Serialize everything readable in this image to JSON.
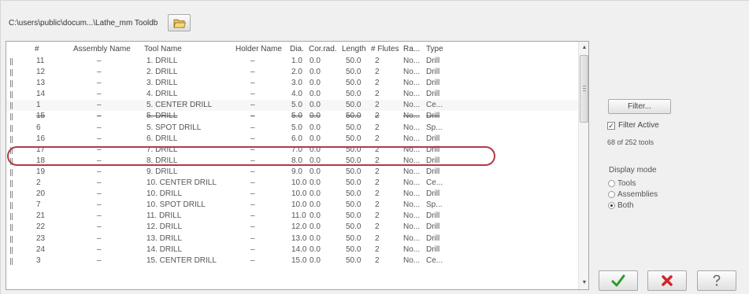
{
  "path": {
    "text": "C:\\users\\public\\docum...\\Lathe_mm Tooldb",
    "browse_icon": "folder-open-icon"
  },
  "columns": [
    "#",
    "Assembly Name",
    "Tool Name",
    "Holder Name",
    "Dia.",
    "Cor.rad.",
    "Length",
    "# Flutes",
    "Ra...",
    "Type"
  ],
  "rows": [
    {
      "num": "11",
      "assembly": "–",
      "tool": "1. DRILL",
      "holder": "–",
      "dia": "1.0",
      "cor": "0.0",
      "length": "50.0",
      "flutes": "2",
      "ra": "No...",
      "type": "Drill"
    },
    {
      "num": "12",
      "assembly": "–",
      "tool": "2. DRILL",
      "holder": "–",
      "dia": "2.0",
      "cor": "0.0",
      "length": "50.0",
      "flutes": "2",
      "ra": "No...",
      "type": "Drill"
    },
    {
      "num": "13",
      "assembly": "–",
      "tool": "3. DRILL",
      "holder": "–",
      "dia": "3.0",
      "cor": "0.0",
      "length": "50.0",
      "flutes": "2",
      "ra": "No...",
      "type": "Drill"
    },
    {
      "num": "14",
      "assembly": "–",
      "tool": "4. DRILL",
      "holder": "–",
      "dia": "4.0",
      "cor": "0.0",
      "length": "50.0",
      "flutes": "2",
      "ra": "No...",
      "type": "Drill"
    },
    {
      "num": "1",
      "assembly": "–",
      "tool": "5. CENTER DRILL",
      "holder": "–",
      "dia": "5.0",
      "cor": "0.0",
      "length": "50.0",
      "flutes": "2",
      "ra": "No...",
      "type": "Ce..."
    },
    {
      "num": "15",
      "assembly": "–",
      "tool": "5. DRILL",
      "holder": "–",
      "dia": "5.0",
      "cor": "0.0",
      "length": "50.0",
      "flutes": "2",
      "ra": "No...",
      "type": "Drill"
    },
    {
      "num": "6",
      "assembly": "–",
      "tool": "5. SPOT DRILL",
      "holder": "–",
      "dia": "5.0",
      "cor": "0.0",
      "length": "50.0",
      "flutes": "2",
      "ra": "No...",
      "type": "Sp..."
    },
    {
      "num": "16",
      "assembly": "–",
      "tool": "6. DRILL",
      "holder": "–",
      "dia": "6.0",
      "cor": "0.0",
      "length": "50.0",
      "flutes": "2",
      "ra": "No...",
      "type": "Drill"
    },
    {
      "num": "17",
      "assembly": "–",
      "tool": "7. DRILL",
      "holder": "–",
      "dia": "7.0",
      "cor": "0.0",
      "length": "50.0",
      "flutes": "2",
      "ra": "No...",
      "type": "Drill"
    },
    {
      "num": "18",
      "assembly": "–",
      "tool": "8. DRILL",
      "holder": "–",
      "dia": "8.0",
      "cor": "0.0",
      "length": "50.0",
      "flutes": "2",
      "ra": "No...",
      "type": "Drill"
    },
    {
      "num": "19",
      "assembly": "–",
      "tool": "9. DRILL",
      "holder": "–",
      "dia": "9.0",
      "cor": "0.0",
      "length": "50.0",
      "flutes": "2",
      "ra": "No...",
      "type": "Drill"
    },
    {
      "num": "2",
      "assembly": "–",
      "tool": "10. CENTER DRILL",
      "holder": "–",
      "dia": "10.0",
      "cor": "0.0",
      "length": "50.0",
      "flutes": "2",
      "ra": "No...",
      "type": "Ce..."
    },
    {
      "num": "20",
      "assembly": "–",
      "tool": "10. DRILL",
      "holder": "–",
      "dia": "10.0",
      "cor": "0.0",
      "length": "50.0",
      "flutes": "2",
      "ra": "No...",
      "type": "Drill"
    },
    {
      "num": "7",
      "assembly": "–",
      "tool": "10. SPOT DRILL",
      "holder": "–",
      "dia": "10.0",
      "cor": "0.0",
      "length": "50.0",
      "flutes": "2",
      "ra": "No...",
      "type": "Sp..."
    },
    {
      "num": "21",
      "assembly": "–",
      "tool": "11. DRILL",
      "holder": "–",
      "dia": "11.0",
      "cor": "0.0",
      "length": "50.0",
      "flutes": "2",
      "ra": "No...",
      "type": "Drill"
    },
    {
      "num": "22",
      "assembly": "–",
      "tool": "12. DRILL",
      "holder": "–",
      "dia": "12.0",
      "cor": "0.0",
      "length": "50.0",
      "flutes": "2",
      "ra": "No...",
      "type": "Drill"
    },
    {
      "num": "23",
      "assembly": "–",
      "tool": "13. DRILL",
      "holder": "–",
      "dia": "13.0",
      "cor": "0.0",
      "length": "50.0",
      "flutes": "2",
      "ra": "No...",
      "type": "Drill"
    },
    {
      "num": "24",
      "assembly": "–",
      "tool": "14. DRILL",
      "holder": "–",
      "dia": "14.0",
      "cor": "0.0",
      "length": "50.0",
      "flutes": "2",
      "ra": "No...",
      "type": "Drill"
    },
    {
      "num": "3",
      "assembly": "–",
      "tool": "15. CENTER DRILL",
      "holder": "–",
      "dia": "15.0",
      "cor": "0.0",
      "length": "50.0",
      "flutes": "2",
      "ra": "No...",
      "type": "Ce..."
    }
  ],
  "highlighted_row_index": 4,
  "strike_row_index": 5,
  "annotation_color": "#b23a48",
  "panel": {
    "filter_button": "Filter...",
    "filter_active_label": "Filter Active",
    "filter_active_checked": true,
    "tool_count": "68 of 252 tools",
    "display_mode_label": "Display mode",
    "modes": [
      {
        "label": "Tools",
        "selected": false
      },
      {
        "label": "Assemblies",
        "selected": false
      },
      {
        "label": "Both",
        "selected": true
      }
    ]
  },
  "buttons": {
    "ok_icon": "checkmark-icon",
    "cancel_icon": "red-x-icon",
    "help_icon": "help-icon",
    "ok_color": "#2e9a2e",
    "cancel_color": "#d2232a"
  }
}
